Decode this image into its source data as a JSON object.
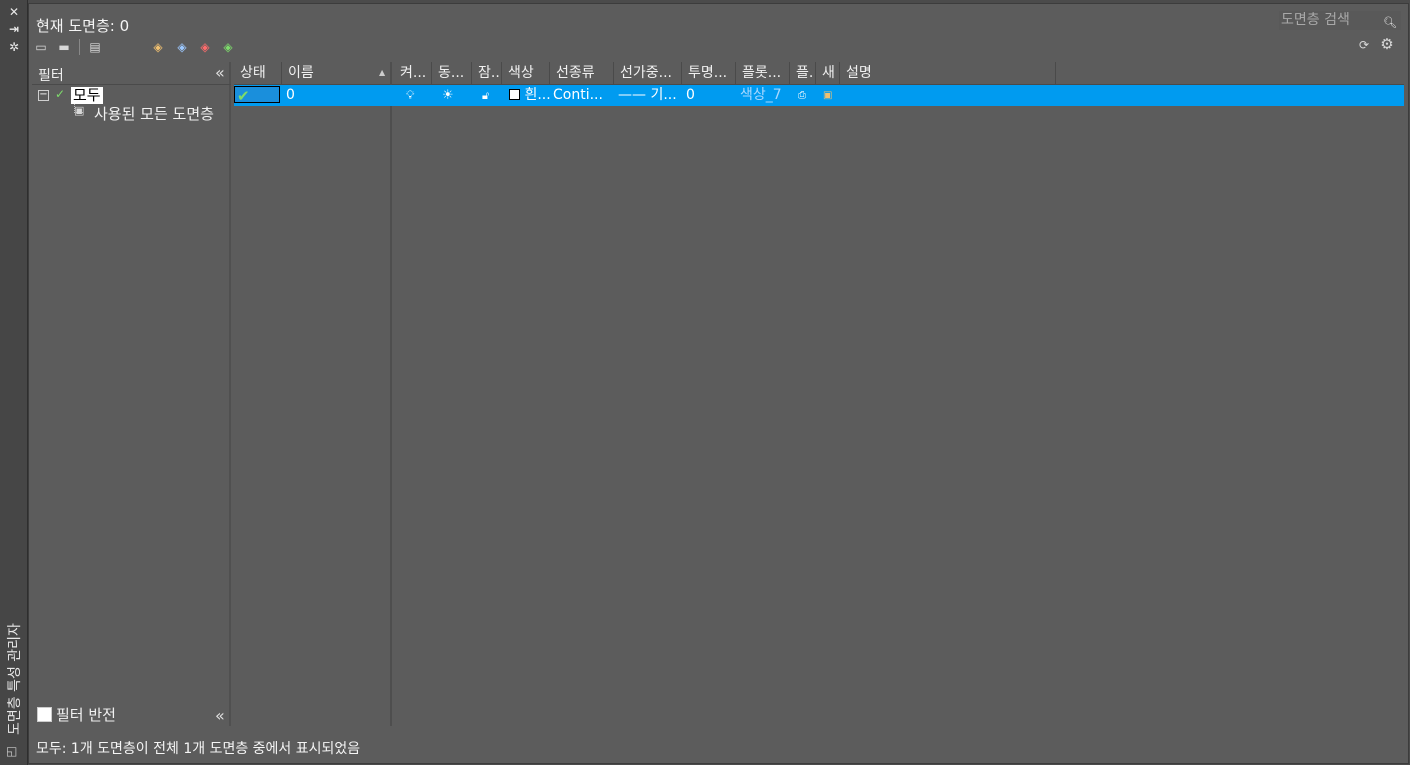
{
  "app": {
    "vertical_title": "도면층 특성 관리자",
    "current_layer_label": "현재 도면층: 0",
    "search_placeholder": "도면층 검색"
  },
  "titlebar_icons": [
    "close-icon",
    "pin-icon",
    "settings-icon"
  ],
  "toolbar_icons": [
    "new-property-filter-icon",
    "new-group-filter-icon",
    "layer-states-manager-icon",
    "new-layer-icon",
    "new-layer-vp-frozen-icon",
    "delete-layer-icon",
    "set-current-icon"
  ],
  "filters": {
    "title": "필터",
    "tree": {
      "root": "모두",
      "child": "사용된 모든 도면층"
    },
    "invert_label": "필터 반전",
    "invert_checked": false
  },
  "columns": {
    "status": "상태",
    "name": "이름",
    "on": "켜...",
    "freeze": "동...",
    "lock": "잠...",
    "color": "색상",
    "linetype": "선종류",
    "lineweight": "선가중...",
    "transparency": "투명...",
    "plotstyle": "플롯...",
    "plot": "플.",
    "newvp": "새",
    "description": "설명"
  },
  "rows": [
    {
      "status": "current",
      "name": "0",
      "color": "흰...",
      "linetype": "Conti...",
      "lineweight": "—— 기...",
      "transparency": "0",
      "plotstyle": "색상_7",
      "description": ""
    }
  ],
  "status_bar": "모두: 1개 도면층이 전체 1개 도면층 중에서 표시되었음",
  "colors": {
    "selection": "#009bf0",
    "panel": "#5c5c5c",
    "plotstyle_text": "#a8d8ff"
  }
}
